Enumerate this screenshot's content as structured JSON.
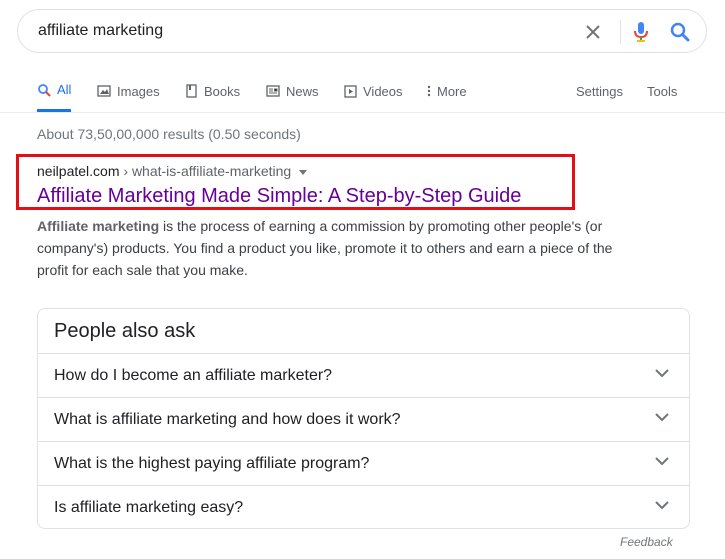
{
  "search": {
    "query": "affiliate marketing"
  },
  "tabs": [
    {
      "label": "All",
      "icon": "search-icon",
      "active": true
    },
    {
      "label": "Images",
      "icon": "image-icon"
    },
    {
      "label": "Books",
      "icon": "book-icon"
    },
    {
      "label": "News",
      "icon": "news-icon"
    },
    {
      "label": "Videos",
      "icon": "video-icon"
    },
    {
      "label": "More",
      "icon": "more-vert-icon"
    }
  ],
  "tools": {
    "settings": "Settings",
    "tools": "Tools"
  },
  "stats": "About 73,50,00,000 results (0.50 seconds)",
  "result": {
    "domain": "neilpatel.com",
    "path": " › what-is-affiliate-marketing",
    "title": "Affiliate Marketing Made Simple: A Step-by-Step Guide",
    "snippet_bold": "Affiliate marketing",
    "snippet_rest": " is the process of earning a commission by promoting other people's (or company's) products. You find a product you like, promote it to others and earn a piece of the profit for each sale that you make."
  },
  "people_also_ask": {
    "heading": "People also ask",
    "questions": [
      "How do I become an affiliate marketer?",
      "What is affiliate marketing and how does it work?",
      "What is the highest paying affiliate program?",
      "Is affiliate marketing easy?"
    ]
  },
  "feedback": "Feedback",
  "colors": {
    "link_visited": "#660099",
    "accent": "#1a73e8",
    "highlight_border": "#e40e15"
  }
}
